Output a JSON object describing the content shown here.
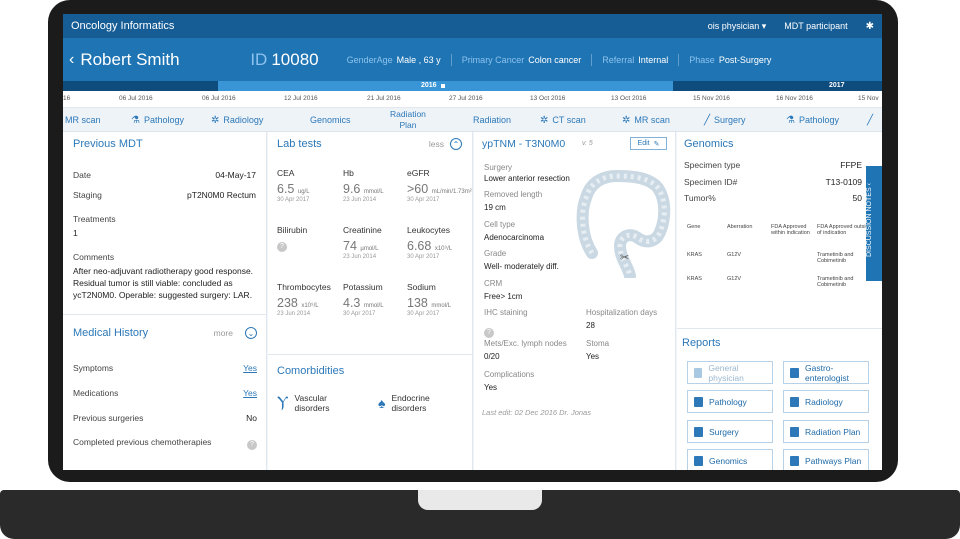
{
  "appbar": {
    "title": "Oncology Informatics",
    "user": "ois physician ▾",
    "role": "MDT participant"
  },
  "patient": {
    "name": "Robert Smith",
    "id_label": "ID",
    "id": "10080",
    "gender_age_label": "GenderAge",
    "gender_age": "Male , 63 y",
    "primary_cancer_label": "Primary Cancer",
    "primary_cancer": "Colon cancer",
    "referral_label": "Referral",
    "referral": "Internal",
    "phase_label": "Phase",
    "phase": "Post-Surgery"
  },
  "timeline": {
    "years": [
      "2016",
      "2017"
    ],
    "dates": [
      "",
      "06 Jul 2016",
      "06 Jul 2016",
      "12 Jul 2016",
      "21 Jul 2016",
      "27 Jul 2016",
      "13 Oct 2016",
      "13 Oct 2016",
      "15 Nov 2016",
      "16 Nov 2016",
      "15 Nov"
    ],
    "events": [
      "MR scan",
      "Pathology",
      "Radiology",
      "Genomics",
      "Radiation",
      "Plan",
      "Radiation",
      "CT scan",
      "MR scan",
      "Surgery",
      "Pathology"
    ]
  },
  "previous_mdt": {
    "title": "Previous MDT",
    "date_label": "Date",
    "date": "04-May-17",
    "staging_label": "Staging",
    "staging": "pT2N0M0 Rectum",
    "treatments_label": "Treatments",
    "treatments": "1",
    "comments_label": "Comments",
    "comments": "After neo-adjuvant radiotherapy good response. Residual tumor is still viable: concluded as ycT2N0M0. Operable: suggested surgery: LAR."
  },
  "medical_history": {
    "title": "Medical History",
    "more": "more",
    "items": [
      {
        "label": "Symptoms",
        "value": "Yes"
      },
      {
        "label": "Medications",
        "value": "Yes"
      },
      {
        "label": "Previous surgeries",
        "value": "No"
      },
      {
        "label": "Completed previous chemotherapies",
        "value": "?"
      }
    ]
  },
  "lab_tests": {
    "title": "Lab tests",
    "less": "less",
    "items": [
      {
        "name": "CEA",
        "value": "6.5",
        "unit": "ug/L",
        "date": "30 Apr 2017"
      },
      {
        "name": "Hb",
        "value": "9.6",
        "unit": "mmol/L",
        "date": "23 Jun 2014"
      },
      {
        "name": "eGFR",
        "value": ">60",
        "unit": "mL/min/1.73m²",
        "date": "30 Apr 2017"
      },
      {
        "name": "Bilirubin",
        "value": "?",
        "unit": "",
        "date": ""
      },
      {
        "name": "Creatinine",
        "value": "74",
        "unit": "µmol/L",
        "date": "23 Jun 2014"
      },
      {
        "name": "Leukocytes",
        "value": "6.68",
        "unit": "x10⁹/L",
        "date": "30 Apr 2017"
      },
      {
        "name": "Thrombocytes",
        "value": "238",
        "unit": "x10⁹/L",
        "date": "23 Jun 2014"
      },
      {
        "name": "Potassium",
        "value": "4.3",
        "unit": "mmol/L",
        "date": "30 Apr 2017"
      },
      {
        "name": "Sodium",
        "value": "138",
        "unit": "mmol/L",
        "date": "30 Apr 2017"
      }
    ]
  },
  "comorbidities": {
    "title": "Comorbidities",
    "items": [
      "Vascular disorders",
      "Endocrine disorders"
    ]
  },
  "pathology": {
    "title": "ypTNM - T3N0M0",
    "version": "v. 5",
    "edit": "Edit",
    "surgery_label": "Surgery",
    "surgery": "Lower anterior resection",
    "removed_length_label": "Removed length",
    "removed_length": "19 cm",
    "cell_type_label": "Cell type",
    "cell_type": "Adenocarcinoma",
    "grade_label": "Grade",
    "grade": "Well- moderately diff.",
    "crm_label": "CRM",
    "crm": "Free> 1cm",
    "ihc_label": "IHC staining",
    "hosp_label": "Hospitalization days",
    "hosp": "28",
    "mets_label": "Mets/Exc. lymph nodes",
    "mets": "0/20",
    "stoma_label": "Stoma",
    "stoma": "Yes",
    "complications_label": "Complications",
    "complications": "Yes",
    "last_edit": "Last edit:  02 Dec 2016  Dr. Jonas"
  },
  "genomics": {
    "title": "Genomics",
    "specimen_type_label": "Specimen type",
    "specimen_type": "FFPE",
    "specimen_id_label": "Specimen ID#",
    "specimen_id": "T13-0109",
    "tumor_label": "Tumor%",
    "tumor": "50",
    "table_headers": [
      "Gene",
      "Aberration",
      "FDA Approved within indication",
      "FDA Approved outside of indication"
    ],
    "rows": [
      [
        "KRAS",
        "G12V",
        "",
        "Trametinib and Cobimetinib"
      ],
      [
        "KRAS",
        "G12V",
        "",
        "Trametinib and Cobimetinib"
      ]
    ]
  },
  "reports": {
    "title": "Reports",
    "items": [
      "General physician",
      "Gastro-enterologist",
      "Pathology",
      "Radiology",
      "Surgery",
      "Radiation Plan",
      "Genomics",
      "Pathways Plan"
    ]
  },
  "discussion_tab": "DISCUSSION NOTES"
}
